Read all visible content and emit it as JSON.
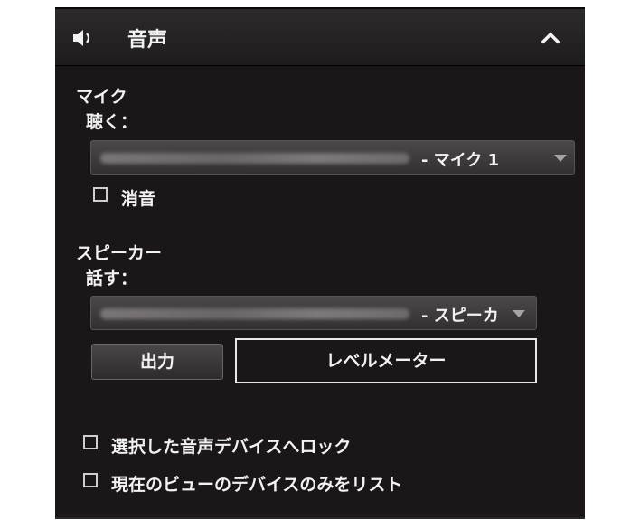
{
  "header": {
    "title": "音声",
    "icon": "speaker-icon",
    "collapse_icon": "chevron-up-icon"
  },
  "microphone": {
    "section_label": "マイク",
    "listen_label": "聴く：",
    "device_suffix": "- マイク 1",
    "mute_label": "消音",
    "mute_checked": false
  },
  "speaker": {
    "section_label": "スピーカー",
    "talk_label": "話す：",
    "device_suffix": "- スピーカ",
    "output_button": "出力",
    "level_meter_label": "レベルメーター"
  },
  "options": {
    "lock_selected": "選択した音声デバイスへロック",
    "lock_selected_checked": false,
    "list_current_view": "現在のビューのデバイスのみをリスト",
    "list_current_view_checked": false
  },
  "colors": {
    "panel_bg": "#1b1718",
    "header_bg": "#2c2a2b",
    "text": "#f2f2f2"
  }
}
